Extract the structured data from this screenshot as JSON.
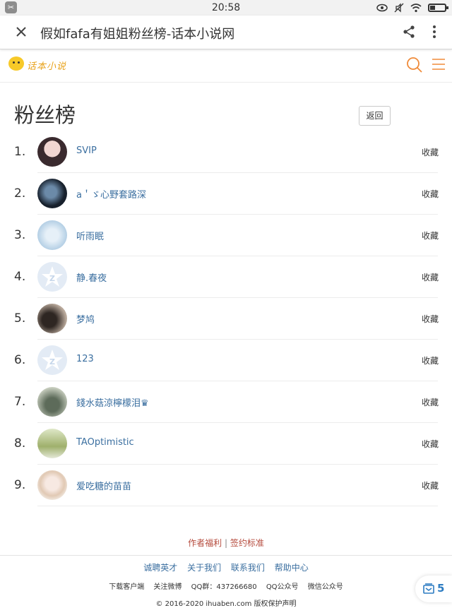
{
  "status_bar": {
    "time": "20:58",
    "app_icon": "scissors-icon"
  },
  "browser_bar": {
    "title": "假如fafa有姐姐粉丝榜-话本小说网"
  },
  "site_header": {
    "logo_text": "话本小说"
  },
  "page": {
    "title": "粉丝榜",
    "back_label": "返回"
  },
  "fans": [
    {
      "rank": "1.",
      "name": "SVIP",
      "action": "收藏"
    },
    {
      "rank": "2.",
      "name": "a＇ゞ心野套路深",
      "action": "收藏"
    },
    {
      "rank": "3.",
      "name": "听雨眠",
      "action": "收藏"
    },
    {
      "rank": "4.",
      "name": "静.春夜",
      "action": "收藏"
    },
    {
      "rank": "5.",
      "name": "梦鸠",
      "action": "收藏"
    },
    {
      "rank": "6.",
      "name": "123",
      "action": "收藏"
    },
    {
      "rank": "7.",
      "name": "錢水菇涼檸檬泪♛",
      "action": "收藏"
    },
    {
      "rank": "8.",
      "name": "TAOptimistic",
      "action": "收藏"
    },
    {
      "rank": "9.",
      "name": "爱吃糖的苗苗",
      "action": "收藏"
    }
  ],
  "footer": {
    "author_welfare": "作者福利",
    "separator": "|",
    "sign_standard": "签约标准",
    "links": [
      "诚聘英才",
      "关于我们",
      "联系我们",
      "帮助中心"
    ],
    "info": [
      "下载客户端",
      "关注微博",
      "QQ群：437266680",
      "QQ公众号",
      "微信公众号"
    ],
    "copyright": "© 2016-2020 ihuaben.com 版权保护声明"
  },
  "float_button": {
    "count": "5"
  },
  "colors": {
    "accent_orange": "#f08b3a",
    "link_blue": "#3b6fa0",
    "footer_red": "#b54a3c"
  }
}
